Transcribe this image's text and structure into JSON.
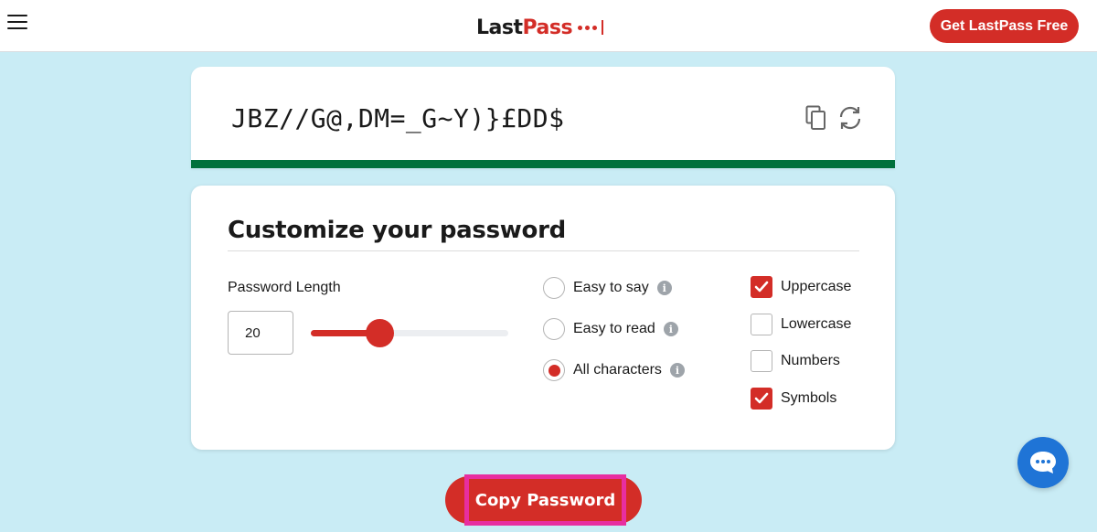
{
  "header": {
    "logo": {
      "part1": "Last",
      "part2": "Pass"
    },
    "cta_label": "Get LastPass Free"
  },
  "generator": {
    "password": "JBZ//G@,DM=_G~Y)}£DD$",
    "strength_color": "#00703c"
  },
  "customize": {
    "title": "Customize your password",
    "length_label": "Password Length",
    "length_value": "20",
    "length_slider": {
      "min": 4,
      "max": 50,
      "value": 20
    },
    "modes": [
      {
        "label": "Easy to say",
        "selected": false
      },
      {
        "label": "Easy to read",
        "selected": false
      },
      {
        "label": "All characters",
        "selected": true
      }
    ],
    "options": [
      {
        "label": "Uppercase",
        "checked": true
      },
      {
        "label": "Lowercase",
        "checked": false
      },
      {
        "label": "Numbers",
        "checked": false
      },
      {
        "label": "Symbols",
        "checked": true
      }
    ]
  },
  "actions": {
    "copy_label": "Copy Password"
  },
  "icons": [
    "menu-icon",
    "copy-icon",
    "refresh-icon",
    "info-icon",
    "checkmark-icon",
    "chat-icon"
  ],
  "colors": {
    "brand_red": "#d32d27",
    "background": "#c9ecf5",
    "chat_blue": "#1f74d6",
    "highlight": "#e82ea0"
  }
}
